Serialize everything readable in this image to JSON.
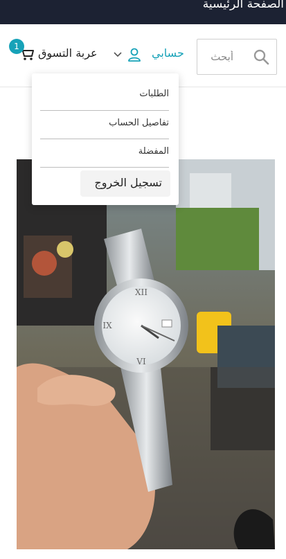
{
  "topbar": {
    "title": "الصفحة الرئيسية"
  },
  "search": {
    "placeholder": "أبحث",
    "icon": "search-icon"
  },
  "account": {
    "label": "حسابي",
    "icon": "user-icon",
    "chevron": "chevron-down-icon"
  },
  "cart": {
    "label": "عربة التسوق",
    "count": "1",
    "icon": "cart-icon"
  },
  "account_menu": {
    "items": [
      {
        "label": "الطلبات"
      },
      {
        "label": "تفاصيل الحساب"
      },
      {
        "label": "المفضلة"
      }
    ],
    "logout_label": "تسجيل الخروج"
  },
  "product_image": {
    "subject": "watch-photo"
  },
  "colors": {
    "topbar": "#1c2233",
    "accent": "#17a2b8"
  }
}
